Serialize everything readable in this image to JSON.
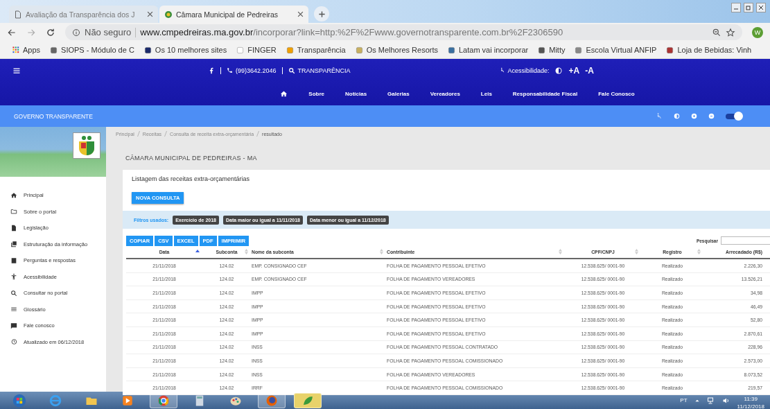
{
  "browser": {
    "tabs": [
      {
        "title": "Avaliação da Transparência dos J",
        "selected": false
      },
      {
        "title": "Câmara Municipal de Pedreiras",
        "selected": true
      }
    ],
    "address": {
      "security": "Não seguro",
      "domain": "www.cmpedreiras.ma.gov.br",
      "path": "/incorporar?link=http:%2F%2Fwww.governotransparente.com.br%2F2306590"
    },
    "profile": "W",
    "bookmarks": [
      {
        "label": "Apps"
      },
      {
        "label": "SIOPS - Módulo de C"
      },
      {
        "label": "Os 10 melhores sites"
      },
      {
        "label": "FINGER"
      },
      {
        "label": "Transparência"
      },
      {
        "label": "Os Melhores Resorts"
      },
      {
        "label": "Latam vai incorporar"
      },
      {
        "label": "Mitty"
      },
      {
        "label": "Escola Virtual ANFIP"
      },
      {
        "label": "Loja de Bebidas: Vinh"
      }
    ]
  },
  "site_header": {
    "phone": "(99)3642.2046",
    "transparency": "TRANSPARÊNCIA",
    "accessibility": "Acessibilidade:",
    "font_controls": [
      "+A",
      "-A"
    ],
    "nav": [
      "Sobre",
      "Notícias",
      "Galerias",
      "Vereadores",
      "Leis",
      "Responsabilidade Fiscal",
      "Fale Conosco"
    ]
  },
  "portal_bar": {
    "title": "GOVERNO TRANSPARENTE",
    "contrast_on": true
  },
  "sidebar": {
    "items": [
      {
        "label": "Principal"
      },
      {
        "label": "Sobre o portal"
      },
      {
        "label": "Legislação"
      },
      {
        "label": "Estruturação da informação"
      },
      {
        "label": "Perguntas e respostas"
      },
      {
        "label": "Acessibilidade"
      },
      {
        "label": "Consultar no portal"
      },
      {
        "label": "Glossário"
      },
      {
        "label": "Fale conosco"
      },
      {
        "label": "Atualizado em 06/12/2018"
      }
    ]
  },
  "breadcrumb": [
    "Principal",
    "Receitas",
    "Consulta de receita extra-orçamentária",
    "resultado"
  ],
  "page_title": "CÂMARA MUNICIPAL DE PEDREIRAS - MA",
  "card": {
    "subtitle": "Listagem das receitas extra-orçamentárias",
    "new_query": "NOVA CONSULTA",
    "filters_label": "Filtros usados:",
    "filters": [
      "Exercício de 2018",
      "Data maior ou igual a 11/11/2018",
      "Data menor ou igual a 11/12/2018"
    ],
    "export_buttons": [
      "COPIAR",
      "CSV",
      "EXCEL",
      "PDF",
      "IMPRIMIR"
    ],
    "search_label": "Pesquisar"
  },
  "table": {
    "columns": [
      {
        "label": "Data",
        "sorted": true
      },
      {
        "label": "Subconta",
        "sorted": false
      },
      {
        "label": "Nome da subconta",
        "sorted": false
      },
      {
        "label": "Contribuinte",
        "sorted": false
      },
      {
        "label": "CPF/CNPJ",
        "sorted": false
      },
      {
        "label": "Registro",
        "sorted": false
      },
      {
        "label": "Arrecadado (R$)"
      }
    ],
    "rows": [
      [
        "21/11/2018",
        "124.02",
        "EMP. CONSIGNADO CEF",
        "FOLHA DE PAGAMENTO PESSOAL EFETIVO",
        "12.538.625/ 0001-90",
        "Realizado",
        "2.226,30"
      ],
      [
        "21/11/2018",
        "124.02",
        "EMP. CONSIGNADO CEF",
        "FOLHA DE PAGAMENTO VEREADORES",
        "12.538.625/ 0001-90",
        "Realizado",
        "13.526,21"
      ],
      [
        "21/11/2018",
        "124.02",
        "IMPP",
        "FOLHA DE PAGAMENTO PESSOAL EFETIVO",
        "12.538.625/ 0001-90",
        "Realizado",
        "34,98"
      ],
      [
        "21/11/2018",
        "124.02",
        "IMPP",
        "FOLHA DE PAGAMENTO PESSOAL EFETIVO",
        "12.538.625/ 0001-90",
        "Realizado",
        "46,49"
      ],
      [
        "21/11/2018",
        "124.02",
        "IMPP",
        "FOLHA DE PAGAMENTO PESSOAL EFETIVO",
        "12.538.625/ 0001-90",
        "Realizado",
        "52,80"
      ],
      [
        "21/11/2018",
        "124.02",
        "IMPP",
        "FOLHA DE PAGAMENTO PESSOAL EFETIVO",
        "12.538.625/ 0001-90",
        "Realizado",
        "2.870,61"
      ],
      [
        "21/11/2018",
        "124.02",
        "INSS",
        "FOLHA DE PAGAMENTO PESSOAL CONTRATADO",
        "12.538.625/ 0001-90",
        "Realizado",
        "228,96"
      ],
      [
        "21/11/2018",
        "124.02",
        "INSS",
        "FOLHA DE PAGAMENTO PESSOAL COMISSIONADO",
        "12.538.625/ 0001-90",
        "Realizado",
        "2.573,00"
      ],
      [
        "21/11/2018",
        "124.02",
        "INSS",
        "FOLHA DE PAGAMENTO VEREADORES",
        "12.538.625/ 0001-90",
        "Realizado",
        "8.073,52"
      ],
      [
        "21/11/2018",
        "124.02",
        "IRRF",
        "FOLHA DE PAGAMENTO PESSOAL COMISSIONADO",
        "12.538.625/ 0001-90",
        "Realizado",
        "219,57"
      ]
    ]
  },
  "taskbar": {
    "language": "PT",
    "time": "11:39",
    "date": "11/12/2018"
  }
}
